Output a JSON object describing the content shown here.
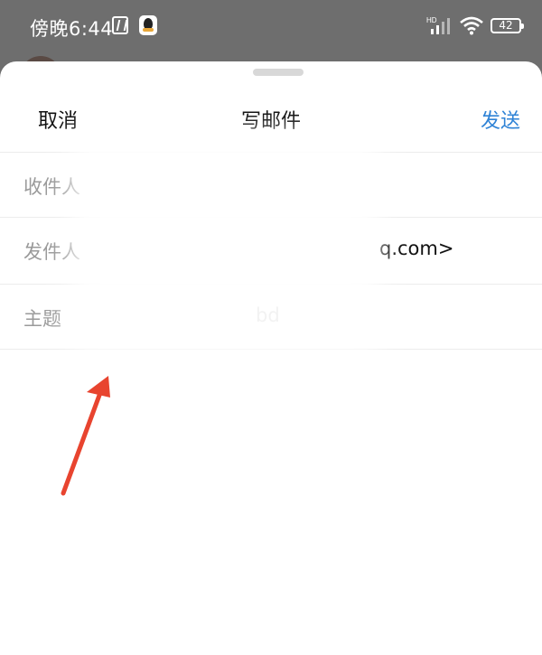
{
  "status_bar": {
    "time": "傍晚6:44",
    "battery": "42",
    "network_label": "HD"
  },
  "compose": {
    "cancel_label": "取消",
    "title": "写邮件",
    "send_label": "发送"
  },
  "fields": {
    "to_label": "收件人",
    "from_label": "发件人",
    "from_value_visible": "q.com>",
    "subject_label": "主题",
    "subject_value_visible": "bd"
  },
  "colors": {
    "accent": "#2f83d6",
    "annotation_arrow": "#e8442f"
  }
}
